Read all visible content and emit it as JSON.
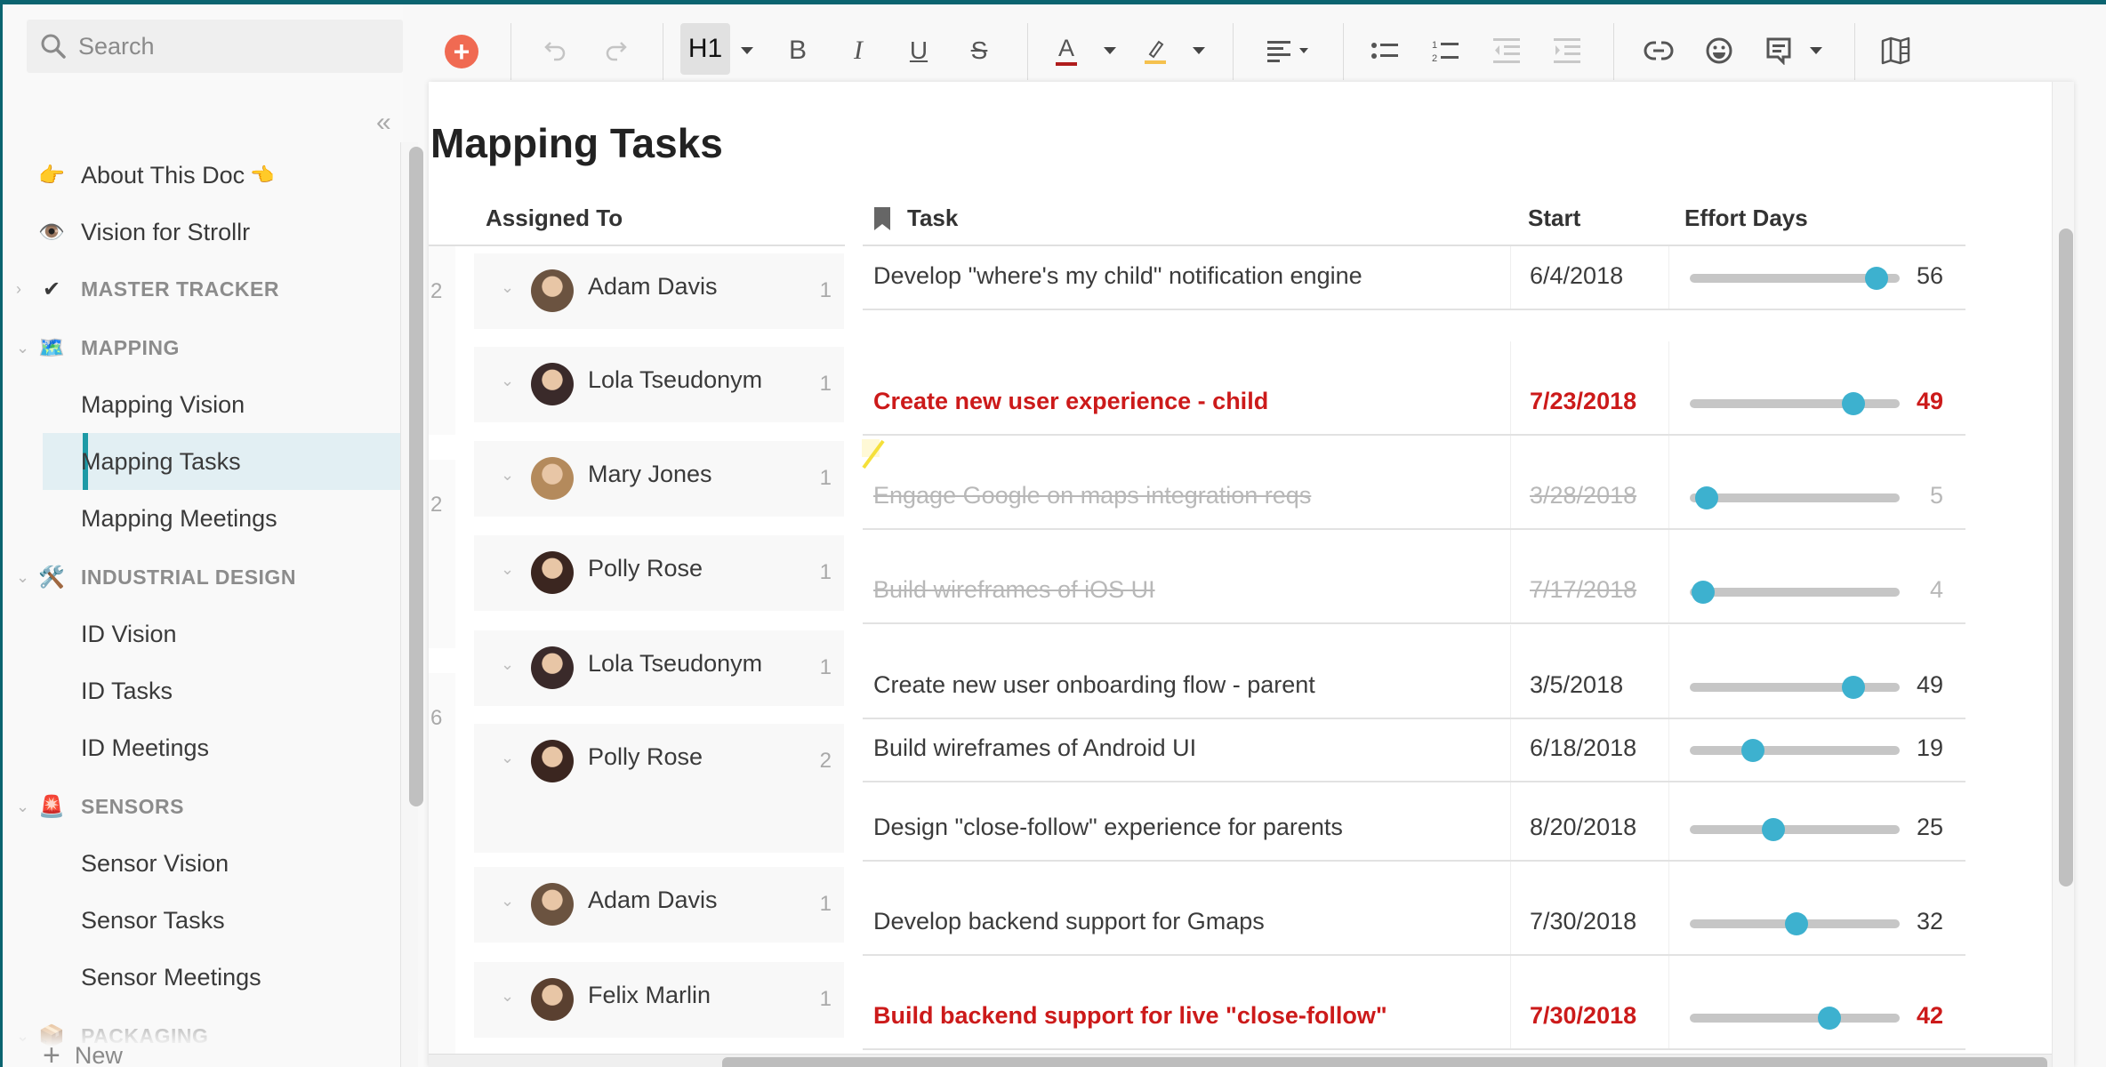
{
  "app": {
    "brand_color": "#0b6470",
    "accent": "#1d9aa6",
    "late_color": "#cc1a1a",
    "slider_color": "#3db1cf",
    "add_color": "#f06a52"
  },
  "sidebar": {
    "search_placeholder": "Search",
    "collapse_label": "«",
    "items": [
      {
        "type": "page",
        "emoji": "👉",
        "label": "About This Doc",
        "suffix_emoji": "👈"
      },
      {
        "type": "page",
        "emoji": "👁️",
        "label": "Vision for Strollr"
      },
      {
        "type": "section",
        "emoji": "✔",
        "label": "MASTER TRACKER",
        "expanded": false
      },
      {
        "type": "section",
        "emoji": "🗺️",
        "label": "MAPPING",
        "expanded": true
      },
      {
        "type": "subpage",
        "label": "Mapping Vision"
      },
      {
        "type": "subpage",
        "label": "Mapping Tasks",
        "active": true
      },
      {
        "type": "subpage",
        "label": "Mapping Meetings"
      },
      {
        "type": "section",
        "emoji": "🛠️",
        "label": "INDUSTRIAL DESIGN",
        "expanded": true
      },
      {
        "type": "subpage",
        "label": "ID Vision"
      },
      {
        "type": "subpage",
        "label": "ID Tasks"
      },
      {
        "type": "subpage",
        "label": "ID Meetings"
      },
      {
        "type": "section",
        "emoji": "🚨",
        "label": "SENSORS",
        "expanded": true
      },
      {
        "type": "subpage",
        "label": "Sensor Vision"
      },
      {
        "type": "subpage",
        "label": "Sensor Tasks"
      },
      {
        "type": "subpage",
        "label": "Sensor Meetings"
      },
      {
        "type": "section",
        "emoji": "📦",
        "label": "PACKAGING",
        "expanded": true
      }
    ],
    "new_label": "New"
  },
  "toolbar": {
    "add": "add-icon",
    "undo": "undo-icon",
    "redo": "redo-icon",
    "heading": "H1",
    "bold": "B",
    "italic": "I",
    "underline": "U",
    "strike": "S",
    "text_color": "A",
    "text_color_swatch": "#b01c1c",
    "highlight_swatch": "#f5c14e",
    "icons": [
      "align-left-icon",
      "bulleted-list-icon",
      "numbered-list-icon",
      "outdent-icon",
      "indent-icon",
      "link-icon",
      "emoji-icon",
      "comment-icon",
      "map-icon"
    ]
  },
  "doc": {
    "title": "Mapping Tasks",
    "columns": {
      "assigned": "Assigned To",
      "task": "Task",
      "start": "Start",
      "effort": "Effort Days"
    },
    "slider_max": 63,
    "groups": [
      {
        "count": "2"
      },
      {
        "count": "2"
      },
      {
        "count": "6"
      }
    ],
    "assignees": [
      {
        "name": "Adam Davis",
        "count": "1",
        "avatar_color": "#6b5340"
      },
      {
        "name": "Lola Tseudonym",
        "count": "1",
        "avatar_color": "#3a2a2a"
      },
      {
        "name": "Mary Jones",
        "count": "1",
        "avatar_color": "#b48a5c"
      },
      {
        "name": "Polly Rose",
        "count": "1",
        "avatar_color": "#3b2620"
      },
      {
        "name": "Lola Tseudonym",
        "count": "1",
        "avatar_color": "#3a2a2a"
      },
      {
        "name": "Polly Rose",
        "count": "2",
        "avatar_color": "#3b2620"
      },
      {
        "name": "Adam Davis",
        "count": "1",
        "avatar_color": "#6b5340"
      },
      {
        "name": "Felix Marlin",
        "count": "1",
        "avatar_color": "#5a4030"
      }
    ],
    "tasks": [
      {
        "task": "Develop \"where's my child\" notification engine",
        "start": "6/4/2018",
        "effort": 56,
        "status": "normal"
      },
      {
        "task": "Create new user experience - child",
        "start": "7/23/2018",
        "effort": 49,
        "status": "late"
      },
      {
        "task": "Engage Google on maps integration reqs",
        "start": "3/28/2018",
        "effort": 5,
        "status": "done"
      },
      {
        "task": "Build wireframes of iOS UI",
        "start": "7/17/2018",
        "effort": 4,
        "status": "done"
      },
      {
        "task": "Create new user onboarding flow - parent",
        "start": "3/5/2018",
        "effort": 49,
        "status": "normal"
      },
      {
        "task": "Build wireframes of Android UI",
        "start": "6/18/2018",
        "effort": 19,
        "status": "normal"
      },
      {
        "task": "Design \"close-follow\" experience for parents",
        "start": "8/20/2018",
        "effort": 25,
        "status": "normal"
      },
      {
        "task": "Develop backend support for Gmaps",
        "start": "7/30/2018",
        "effort": 32,
        "status": "normal"
      },
      {
        "task": "Build backend support for live \"close-follow\"",
        "start": "7/30/2018",
        "effort": 42,
        "status": "late"
      }
    ]
  }
}
